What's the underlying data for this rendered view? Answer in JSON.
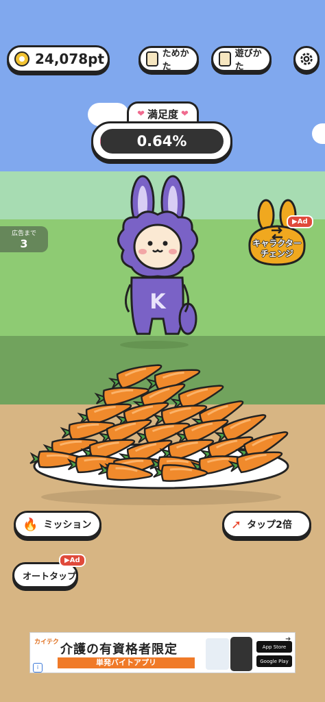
{
  "header": {
    "points": "24,078pt",
    "how_to_save": "ためかた",
    "how_to_play": "遊びかた",
    "settings_icon": "gear-icon"
  },
  "satisfaction": {
    "label": "満足度",
    "value_text": "0.64%",
    "fraction": 0.0064
  },
  "ad_counter": {
    "label": "広告まで",
    "count": "3"
  },
  "character_change": {
    "label_line1": "キャラクター",
    "label_line2": "チェンジ",
    "ad_badge": "Ad"
  },
  "buttons": {
    "mission": "ミッション",
    "tap_double": "タップ2倍",
    "auto_tap": "オートタップ",
    "auto_tap_badge": "Ad"
  },
  "banner": {
    "brand": "カイテク",
    "headline": "介護の有資格者限定",
    "sub": "単発バイトアプリ",
    "app_store": "App Store",
    "google_play": "Google Play"
  },
  "colors": {
    "sky": "#80a8ee",
    "grass": "#8ecb73",
    "ground": "#d7b583",
    "rabbit": "#7a62c6",
    "carrot": "#f08a2c",
    "accent_pink": "#f06b8f"
  }
}
